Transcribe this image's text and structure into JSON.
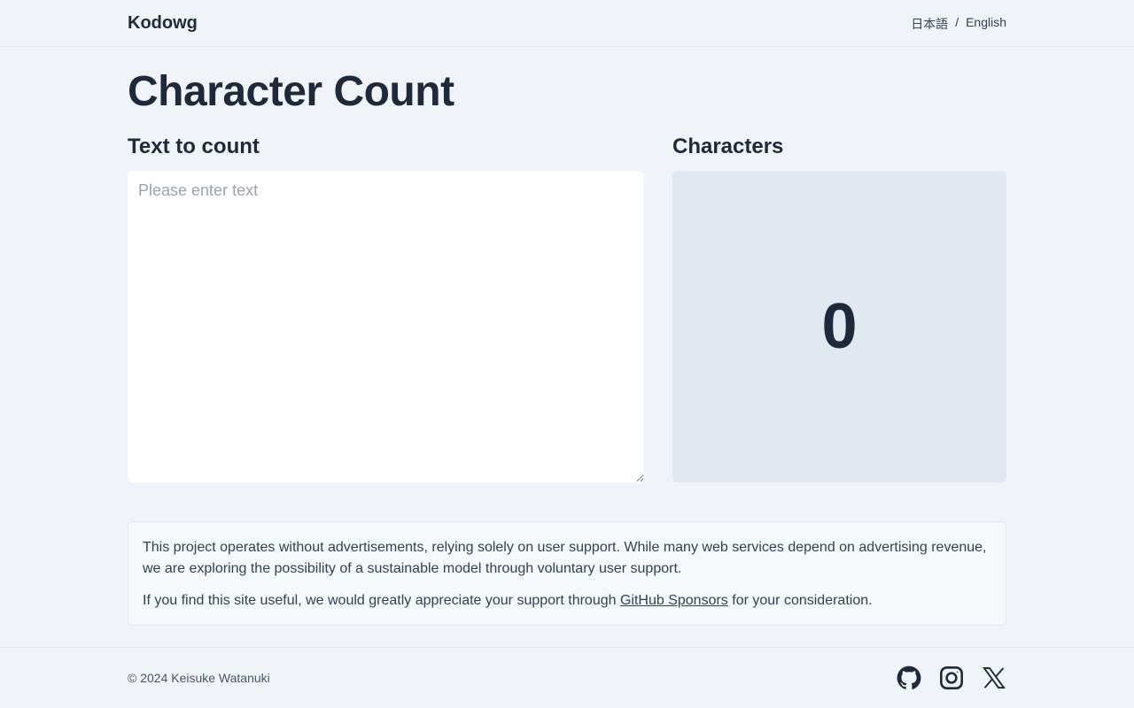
{
  "header": {
    "brand": "Kodowg",
    "lang_ja": "日本語",
    "lang_sep": "/",
    "lang_en": "English"
  },
  "main": {
    "title": "Character Count",
    "input_label": "Text to count",
    "input_placeholder": "Please enter text",
    "input_value": "",
    "count_label": "Characters",
    "count_value": "0"
  },
  "notice": {
    "para1": "This project operates without advertisements, relying solely on user support. While many web services depend on advertising revenue, we are exploring the possibility of a sustainable model through voluntary user support.",
    "para2_before": "If you find this site useful, we would greatly appreciate your support through ",
    "para2_link": "GitHub Sponsors",
    "para2_after": " for your consideration."
  },
  "footer": {
    "copyright": "© 2024 Keisuke Watanuki",
    "icons": [
      "github-icon",
      "instagram-icon",
      "x-icon"
    ]
  },
  "colors": {
    "background": "#f0f4f8",
    "text": "#1e293b",
    "count_panel": "#e2e8f0"
  }
}
